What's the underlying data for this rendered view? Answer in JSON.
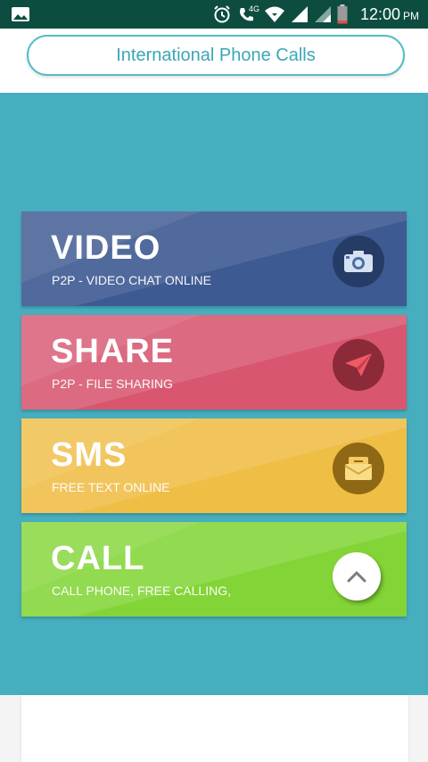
{
  "status_bar": {
    "time": "12:00",
    "ampm": "PM",
    "network_label": "4G",
    "icons": [
      "image-icon",
      "alarm-icon",
      "wifi-call-icon",
      "wifi-icon",
      "signal-icon",
      "signal-icon-2",
      "battery-icon"
    ]
  },
  "header": {
    "button_label": "International Phone Calls"
  },
  "cards": [
    {
      "title": "VIDEO",
      "subtitle": "P2P - VIDEO CHAT ONLINE",
      "icon": "camera-icon",
      "color": "#3e5a92"
    },
    {
      "title": "SHARE",
      "subtitle": "P2P - FILE SHARING",
      "icon": "paper-plane-icon",
      "color": "#d8566f"
    },
    {
      "title": "SMS",
      "subtitle": "FREE TEXT ONLINE",
      "icon": "message-icon",
      "color": "#efbe45"
    },
    {
      "title": "CALL",
      "subtitle": "CALL PHONE, FREE CALLING,",
      "icon": "chevron-up-icon",
      "color": "#83d537"
    }
  ],
  "colors": {
    "status_bar": "#0c4d40",
    "teal": "#46aebf",
    "accent": "#3aa7b6"
  }
}
